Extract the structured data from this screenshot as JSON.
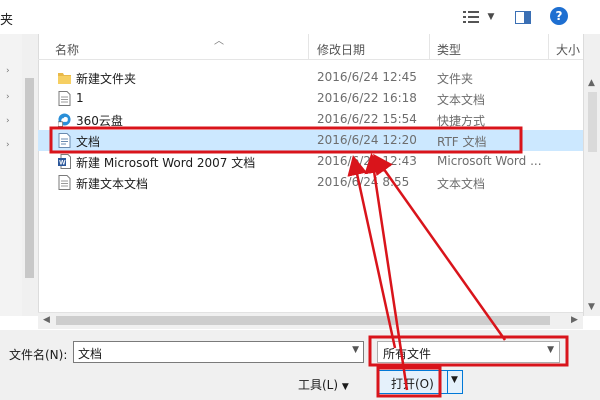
{
  "header": {
    "breadcrumb": "夹",
    "columns": [
      "名称",
      "修改日期",
      "类型",
      "大小"
    ]
  },
  "files": [
    {
      "name": "新建文件夹",
      "date": "2016/6/24 12:45",
      "type": "文件夹",
      "icon": "folder-icon",
      "selected": false
    },
    {
      "name": "1",
      "date": "2016/6/22 16:18",
      "type": "文本文档",
      "icon": "text-file-icon",
      "selected": false
    },
    {
      "name": "360云盘",
      "date": "2016/6/22 15:54",
      "type": "快捷方式",
      "icon": "cloud-shortcut-icon",
      "selected": false
    },
    {
      "name": "文档",
      "date": "2016/6/24 12:20",
      "type": "RTF 文档",
      "icon": "rtf-file-icon",
      "selected": true
    },
    {
      "name": "新建 Microsoft Word 2007 文档",
      "date": "2016/6/24 12:43",
      "type": "Microsoft Word ...",
      "icon": "word-file-icon",
      "selected": false
    },
    {
      "name": "新建文本文档",
      "date": "2016/6/24 8:55",
      "type": "文本文档",
      "icon": "text-file-icon",
      "selected": false
    }
  ],
  "footer": {
    "filename_label": "文件名(N):",
    "filename_value": "文档",
    "filter_value": "所有文件",
    "tools_label": "工具(L)",
    "open_label": "打开(O)"
  },
  "colors": {
    "selection": "#cce8ff",
    "annotation": "#d9141b",
    "accent": "#0078d7"
  }
}
